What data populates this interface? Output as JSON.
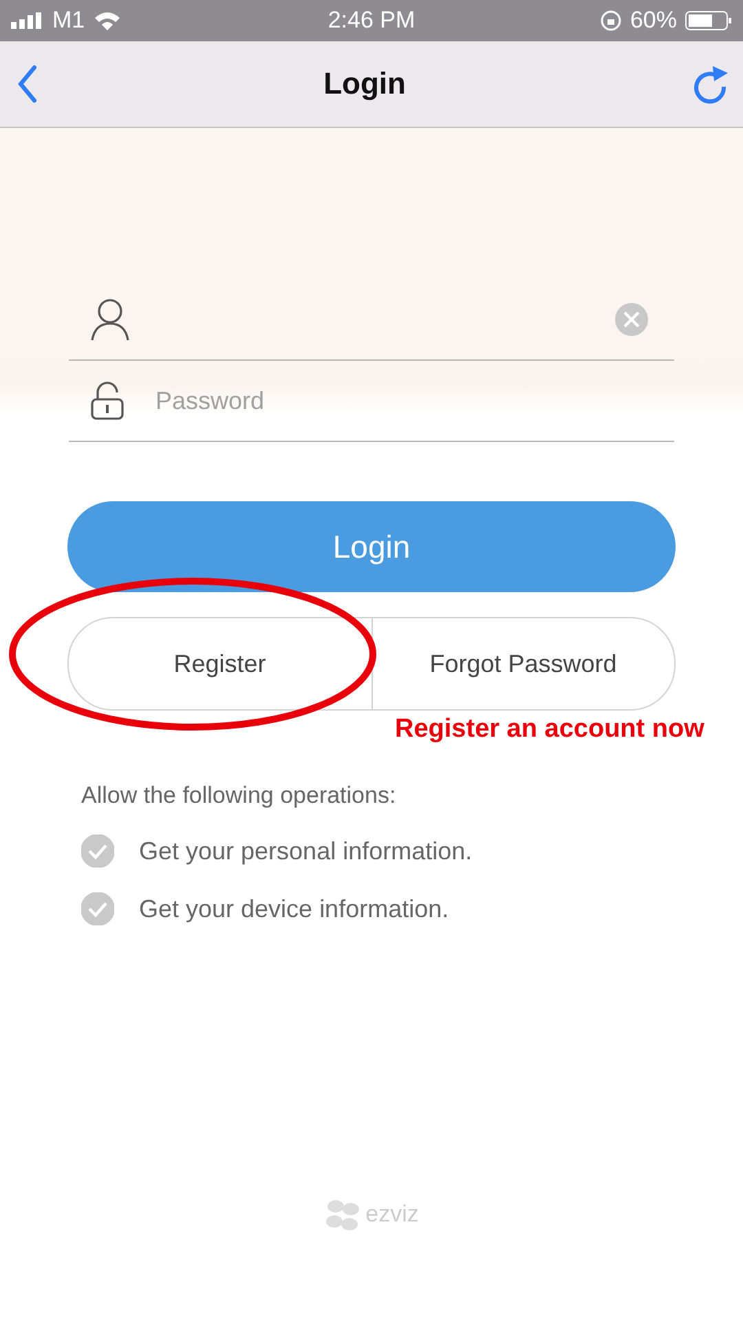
{
  "status_bar": {
    "carrier": "M1",
    "time": "2:46 PM",
    "battery": "60%"
  },
  "nav": {
    "title": "Login"
  },
  "form": {
    "password": {
      "placeholder": "Password"
    },
    "login_button": "Login",
    "register_button": "Register",
    "forgot_button": "Forgot Password"
  },
  "permissions": {
    "heading": "Allow the following operations:",
    "items": [
      {
        "label": "Get your personal information.",
        "checked": true
      },
      {
        "label": "Get your device information.",
        "checked": true
      }
    ]
  },
  "annotation": {
    "text": "Register an account now"
  },
  "footer": {
    "logo": "ezviz"
  }
}
